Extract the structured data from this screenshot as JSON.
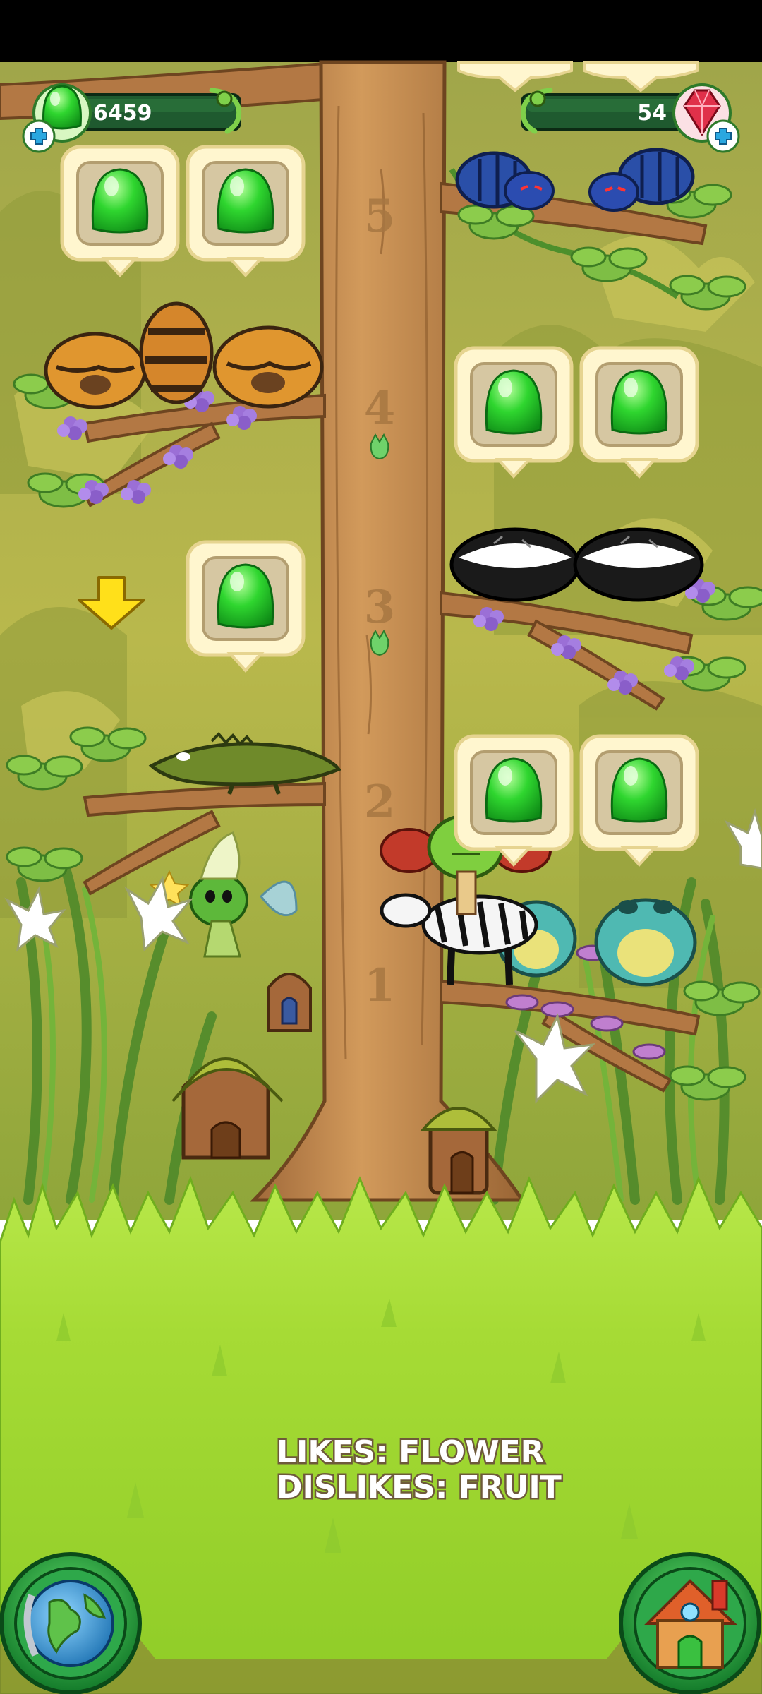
{
  "hud": {
    "jelly_count": "6459",
    "gem_count": "54"
  },
  "tree": {
    "level_markers": [
      "5",
      "4",
      "3",
      "2",
      "1"
    ]
  },
  "info": {
    "likes": "LIKES: FLOWER",
    "dislikes": "DISLIKES: FRUIT"
  },
  "colors": {
    "sky_dark": "#000000",
    "grass": "#9ad62a",
    "grass_light": "#b6e543",
    "trunk": "#c4874a",
    "jelly_green": "#2fd62f",
    "card_cream": "#fff3c4",
    "hud_bar": "#1f5a2f",
    "gem_red": "#e0304a"
  },
  "icons": {
    "jelly": "green-jelly-icon",
    "gem": "red-gem-icon",
    "globe": "globe-icon",
    "house": "house-icon",
    "arrow": "down-arrow-icon"
  }
}
